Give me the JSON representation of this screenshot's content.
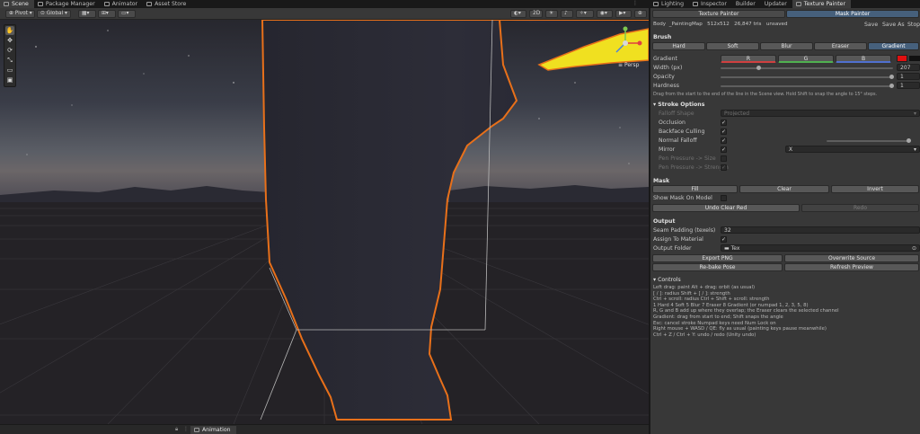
{
  "left_tabs": [
    "Scene",
    "Package Manager",
    "Animator",
    "Asset Store"
  ],
  "right_tabs": [
    "Lighting",
    "Inspector",
    "Builder",
    "Updater",
    "Texture Painter"
  ],
  "toolbar": {
    "pivot": "Pivot",
    "global": "Global",
    "mode_2d": "2D"
  },
  "gizmo_label": "Persp",
  "bottom_tab": "Animation",
  "panel": {
    "painter_tabs": [
      "Texture Painter",
      "Mask Painter"
    ],
    "body_label": "Body",
    "map_name": "_PaintingMap",
    "map_size": "512x512",
    "tris": "26,847 tris",
    "status": "unsaved",
    "save": "Save",
    "save_as": "Save As",
    "stop": "Stop",
    "brush_header": "Brush",
    "brush_modes": [
      "Hard",
      "Soft",
      "Blur",
      "Eraser",
      "Gradient"
    ],
    "active_brush": "Gradient",
    "gradient_label": "Gradient",
    "channels": [
      "R",
      "G",
      "B"
    ],
    "width_label": "Width (px)",
    "width_value": "207",
    "opacity_label": "Opacity",
    "opacity_value": "1",
    "hardness_label": "Hardness",
    "hardness_value": "1",
    "hint": "Drag from the start to the end of the line in the Scene view. Hold Shift to snap the angle to 15° steps.",
    "stroke_header": "Stroke Options",
    "falloff_label": "Falloff Shape",
    "falloff_value": "Projected",
    "occlusion": "Occlusion",
    "backface": "Backface Culling",
    "normal_falloff": "Normal Falloff",
    "mirror": "Mirror",
    "mirror_axis": "X",
    "pen_size": "Pen Pressure -> Size",
    "pen_strength": "Pen Pressure -> Strength",
    "mask_header": "Mask",
    "fill": "Fill",
    "clear": "Clear",
    "invert": "Invert",
    "show_mask": "Show Mask On Model",
    "undo_clear": "Undo Clear Red",
    "redo": "Redo",
    "output_header": "Output",
    "seam_label": "Seam Padding (texels)",
    "seam_value": "32",
    "assign_label": "Assign To Material",
    "folder_label": "Output Folder",
    "folder_value": "Tex",
    "export_png": "Export PNG",
    "overwrite": "Overwrite Source",
    "rebake": "Re-bake Pose",
    "refresh": "Refresh Preview",
    "controls_header": "Controls",
    "controls_lines": [
      "Left drag: paint    Alt + drag: orbit (as usual)",
      "[ / ]: radius    Shift + [ / ]: strength",
      "Ctrl + scroll: radius    Ctrl + Shift + scroll: strength",
      "1 Hard   4 Soft   5 Blur   7 Eraser   8 Gradient    (or numpad 1, 2, 3, 5, 8)",
      "R, G and B add up where they overlap; the Eraser clears the selected channel",
      "Gradient: drag from start to end; Shift snaps the angle",
      "Esc: cancel stroke    Numpad keys need Num Lock on",
      "Right mouse + WASD / QE: fly as usual (painting keys pause meanwhile)",
      "Ctrl + Z / Ctrl + Y: undo / redo (Unity undo)"
    ]
  },
  "colors": {
    "accent": "#46607c",
    "gradient_color": "#e01010",
    "outline": "#e8701a",
    "selection": "#f0e020"
  }
}
